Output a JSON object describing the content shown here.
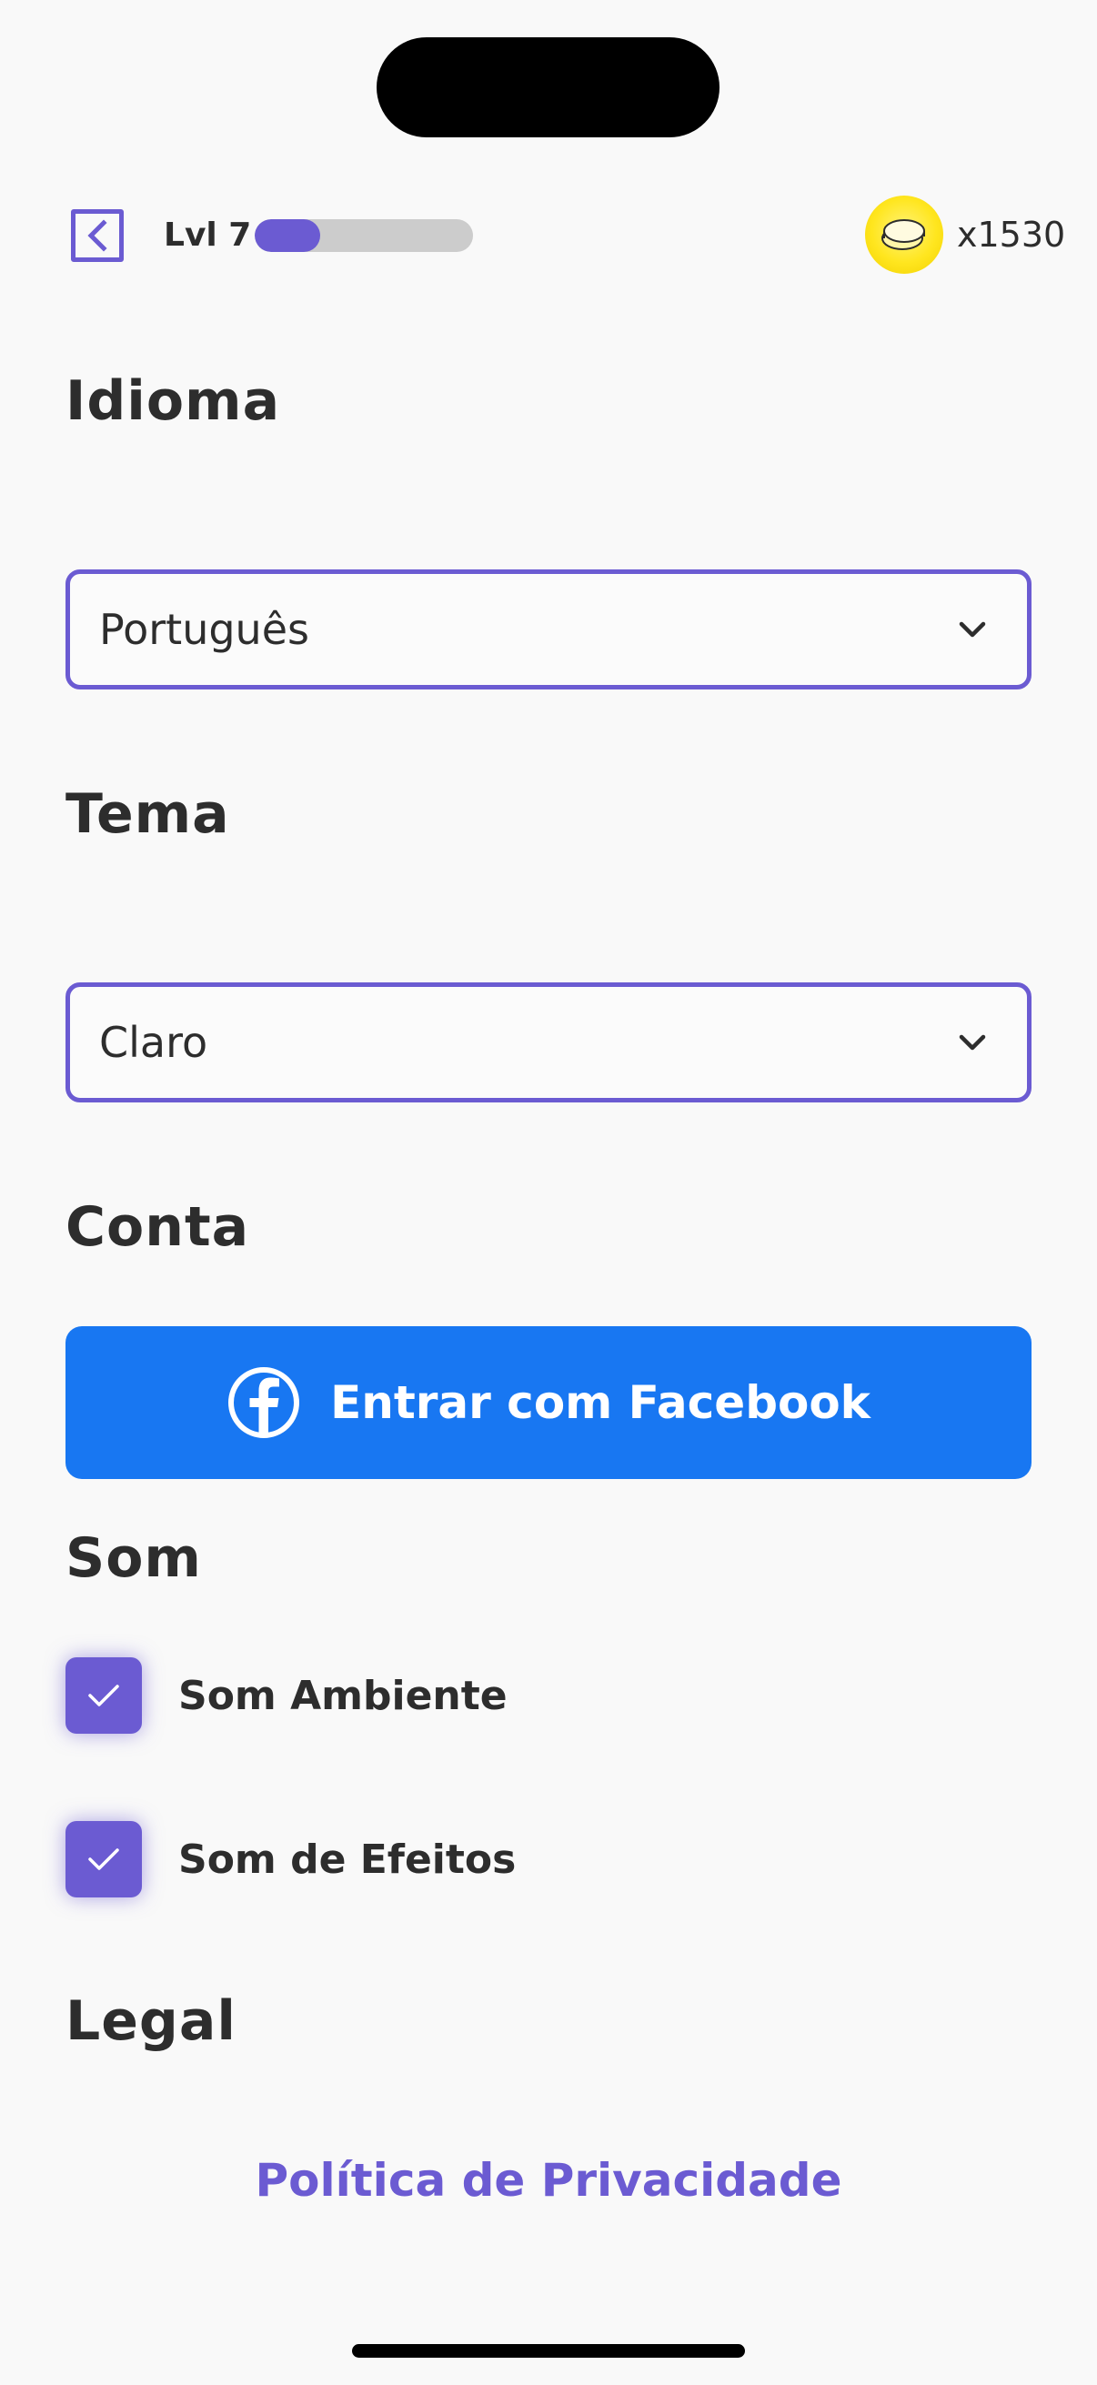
{
  "header": {
    "level_label": "Lvl 7",
    "xp_progress": 0.3,
    "coins": "x1530"
  },
  "sections": {
    "language": {
      "title": "Idioma",
      "selected": "Português"
    },
    "theme": {
      "title": "Tema",
      "selected": "Claro"
    },
    "account": {
      "title": "Conta",
      "facebook_button": "Entrar com Facebook"
    },
    "sound": {
      "title": "Som",
      "options": [
        {
          "label": "Som Ambiente",
          "checked": true
        },
        {
          "label": "Som de Efeitos",
          "checked": true
        }
      ]
    },
    "legal": {
      "title": "Legal",
      "privacy_link": "Política de Privacidade"
    }
  },
  "colors": {
    "accent": "#6b5bd2",
    "facebook": "#1877f2",
    "coin": "#ffe61f",
    "text": "#2d2d2d",
    "background": "#f9f9f9"
  },
  "icons": {
    "back": "back-arrow-icon",
    "coin": "coin-icon",
    "dropdown": "chevron-down-icon",
    "facebook": "facebook-icon",
    "check": "check-icon"
  }
}
